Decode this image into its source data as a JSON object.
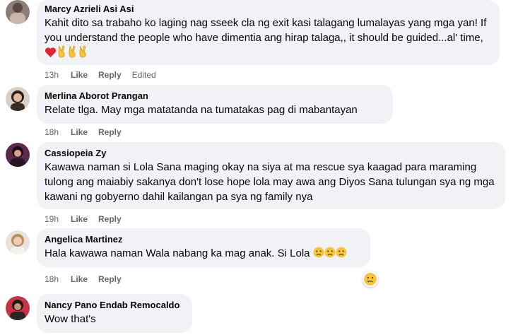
{
  "comments": [
    {
      "author": "Marcy Azrieli Asi Asi",
      "text": "Kahit dito sa trabaho ko laging nag sseek cla ng exit kasi talagang lumalayas yang mga yan! If you understand the people who have dimentia ang hirap talaga,, it should be guided...al' time,",
      "time": "13h",
      "like": "Like",
      "reply": "Reply",
      "edited": "Edited",
      "trailing_emojis": [
        "red-heart",
        "victory-hand",
        "victory-hand",
        "victory-hand"
      ]
    },
    {
      "author": "Merlina Aborot Prangan",
      "text": "Relate tlga. May mga matatanda na tumatakas pag di mabantayan",
      "time": "18h",
      "like": "Like",
      "reply": "Reply"
    },
    {
      "author": "Cassiopeia Zy",
      "text": "Kawawa naman si Lola Sana maging okay na siya at ma rescue sya kaagad para maraming tulong ang maiabiy sakanya don't lose hope lola may awa ang Diyos Sana tulungan sya ng mga kawani ng gobyerno dahil kailangan pa sya ng family nya",
      "time": "19h",
      "like": "Like",
      "reply": "Reply"
    },
    {
      "author": "Angelica Martinez",
      "text": "Hala kawawa naman Wala nabang ka mag anak. Si Lola",
      "time": "18h",
      "like": "Like",
      "reply": "Reply",
      "trailing_emojis": [
        "sad-face",
        "sad-face",
        "sad-face"
      ],
      "reaction": "sad-reaction"
    },
    {
      "author": "Nancy Pano Endab Remocaldo",
      "text": "Wow that's"
    }
  ],
  "colors": {
    "bubble": "#f0f2f5",
    "meta": "#65676b",
    "text": "#050505"
  }
}
